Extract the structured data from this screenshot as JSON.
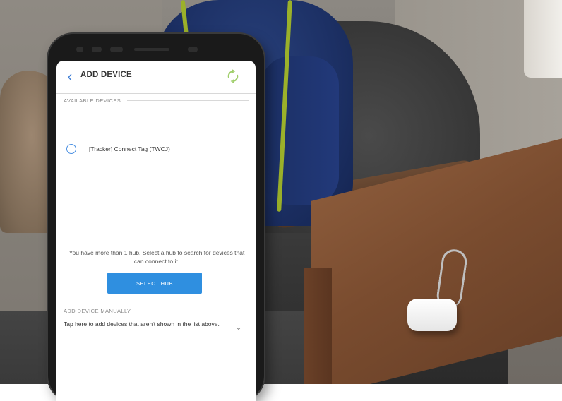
{
  "app": {
    "title": "ADD DEVICE"
  },
  "available_devices": {
    "label": "AVAILABLE DEVICES",
    "items": [
      {
        "name": "[Tracker] Connect Tag (TWCJ)"
      }
    ]
  },
  "hub": {
    "message": "You have more than 1 hub. Select a hub to search for devices that can connect to it.",
    "button_label": "SELECT HUB"
  },
  "manual": {
    "label": "ADD DEVICE MANUALLY",
    "description": "Tap here to add devices that aren't shown in the list above."
  },
  "colors": {
    "accent": "#2f8fe0",
    "back_arrow": "#3a7bd5"
  },
  "icons": {
    "back": "chevron-left-icon",
    "refresh": "refresh-icon",
    "radio": "radio-icon",
    "expand": "chevron-down-icon"
  }
}
